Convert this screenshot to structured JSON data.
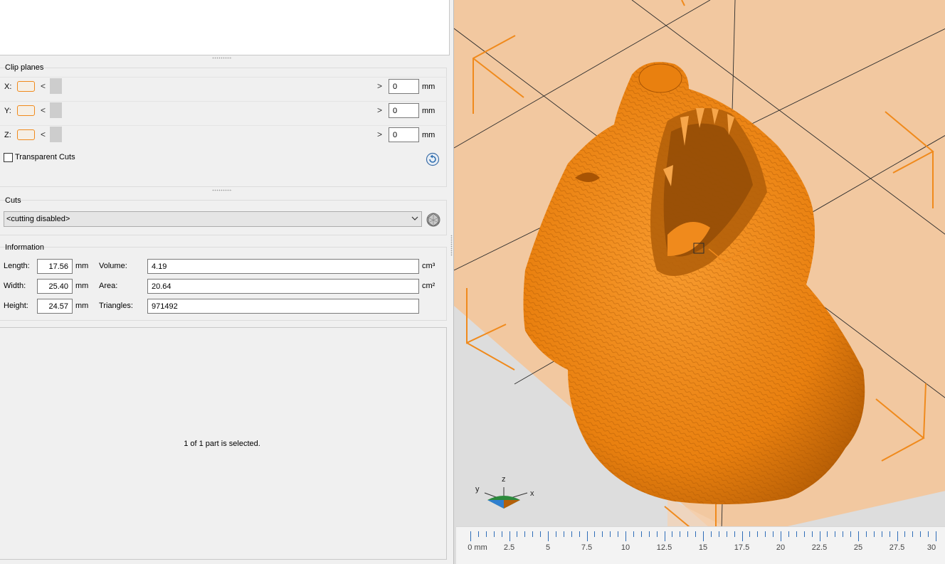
{
  "clip_planes": {
    "title": "Clip planes",
    "rows": [
      {
        "axis": "X:",
        "value": "0",
        "unit": "mm"
      },
      {
        "axis": "Y:",
        "value": "0",
        "unit": "mm"
      },
      {
        "axis": "Z:",
        "value": "0",
        "unit": "mm"
      }
    ],
    "transparent_cuts_label": "Transparent Cuts",
    "arrow_left": "<",
    "arrow_right": ">"
  },
  "cuts": {
    "title": "Cuts",
    "selected": "<cutting disabled>"
  },
  "information": {
    "title": "Information",
    "length_label": "Length:",
    "length": "17.56",
    "length_unit": "mm",
    "width_label": "Width:",
    "width": "25.40",
    "width_unit": "mm",
    "height_label": "Height:",
    "height": "24.57",
    "height_unit": "mm",
    "volume_label": "Volume:",
    "volume": "4.19",
    "volume_unit": "cm³",
    "area_label": "Area:",
    "area": "20.64",
    "area_unit": "cm²",
    "triangles_label": "Triangles:",
    "triangles": "971492"
  },
  "status": "1 of 1 part is selected.",
  "axis_gizmo": {
    "x": "x",
    "y": "y",
    "z": "z"
  },
  "ruler": {
    "labels": [
      "0 mm",
      "2.5",
      "5",
      "7.5",
      "10",
      "12.5",
      "15",
      "17.5",
      "20",
      "22.5",
      "25",
      "27.5",
      "30"
    ]
  },
  "colors": {
    "model": "#f08a1c",
    "build_plate": "#f2c8a0",
    "accent": "#f08a1c"
  }
}
